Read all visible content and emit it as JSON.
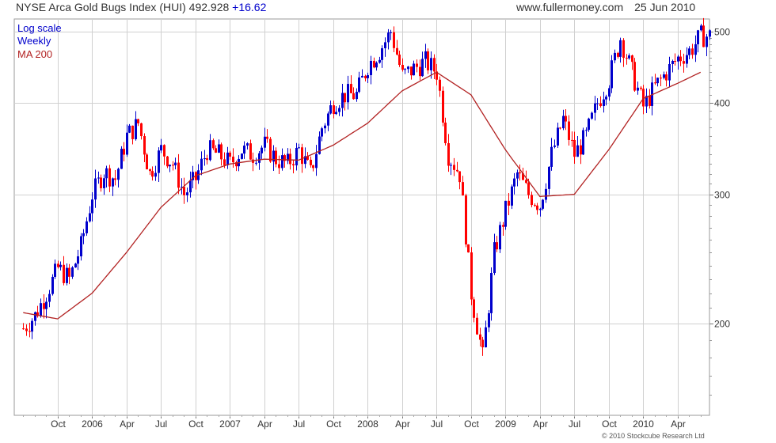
{
  "header": {
    "instrument": "NYSE Arca Gold Bugs Index (HUI)",
    "last": "492.928",
    "change": "+16.62",
    "site": "www.fullermoney.com",
    "date": "25 Jun 2010"
  },
  "legend": {
    "scale": "Log scale",
    "period": "Weekly",
    "ma": "MA 200"
  },
  "copyright": "© 2010 Stockcube Research Ltd",
  "colors": {
    "up": "#0000cc",
    "down": "#ff0000",
    "ma": "#b22222",
    "grid": "#d0d0d0"
  },
  "chart_data": {
    "type": "candlestick",
    "frequency": "weekly",
    "y_scale": "log",
    "ylim": [
      150,
      520
    ],
    "y_ticks": [
      200,
      300,
      400,
      500
    ],
    "x_ticks": [
      "Oct",
      "2006",
      "Apr",
      "Jul",
      "Oct",
      "2007",
      "Apr",
      "Jul",
      "Oct",
      "2008",
      "Apr",
      "Jul",
      "Oct",
      "2009",
      "Apr",
      "Jul",
      "Oct",
      "2010",
      "Apr"
    ],
    "x_range_months": [
      "2005-07",
      "2010-06"
    ],
    "grid": true,
    "series": [
      {
        "kind": "close",
        "points": [
          [
            "2005-07",
            197
          ],
          [
            "2005-08",
            205
          ],
          [
            "2005-09",
            220
          ],
          [
            "2005-10",
            238
          ],
          [
            "2005-11",
            230
          ],
          [
            "2005-12",
            255
          ],
          [
            "2006-01",
            300
          ],
          [
            "2006-02",
            322
          ],
          [
            "2006-03",
            315
          ],
          [
            "2006-04",
            360
          ],
          [
            "2006-05",
            375
          ],
          [
            "2006-06",
            320
          ],
          [
            "2006-07",
            345
          ],
          [
            "2006-08",
            330
          ],
          [
            "2006-09",
            300
          ],
          [
            "2006-10",
            315
          ],
          [
            "2006-11",
            345
          ],
          [
            "2006-12",
            340
          ],
          [
            "2007-01",
            330
          ],
          [
            "2007-02",
            345
          ],
          [
            "2007-03",
            340
          ],
          [
            "2007-04",
            350
          ],
          [
            "2007-05",
            335
          ],
          [
            "2007-06",
            330
          ],
          [
            "2007-07",
            345
          ],
          [
            "2007-08",
            320
          ],
          [
            "2007-09",
            370
          ],
          [
            "2007-10",
            400
          ],
          [
            "2007-11",
            410
          ],
          [
            "2007-12",
            410
          ],
          [
            "2008-01",
            450
          ],
          [
            "2008-02",
            470
          ],
          [
            "2008-03",
            500
          ],
          [
            "2008-04",
            435
          ],
          [
            "2008-05",
            445
          ],
          [
            "2008-06",
            455
          ],
          [
            "2008-07",
            440
          ],
          [
            "2008-08",
            340
          ],
          [
            "2008-09",
            320
          ],
          [
            "2008-10",
            220
          ],
          [
            "2008-11",
            180
          ],
          [
            "2008-12",
            250
          ],
          [
            "2009-01",
            285
          ],
          [
            "2009-02",
            320
          ],
          [
            "2009-03",
            300
          ],
          [
            "2009-04",
            290
          ],
          [
            "2009-05",
            340
          ],
          [
            "2009-06",
            380
          ],
          [
            "2009-07",
            340
          ],
          [
            "2009-08",
            360
          ],
          [
            "2009-09",
            400
          ],
          [
            "2009-10",
            430
          ],
          [
            "2009-11",
            490
          ],
          [
            "2009-12",
            440
          ],
          [
            "2010-01",
            395
          ],
          [
            "2010-02",
            420
          ],
          [
            "2010-03",
            440
          ],
          [
            "2010-04",
            460
          ],
          [
            "2010-05",
            470
          ],
          [
            "2010-06",
            493
          ]
        ]
      },
      {
        "kind": "ma",
        "name": "MA 200",
        "points": [
          [
            "2005-07",
            207
          ],
          [
            "2005-10",
            203
          ],
          [
            "2006-01",
            220
          ],
          [
            "2006-04",
            250
          ],
          [
            "2006-07",
            288
          ],
          [
            "2006-10",
            318
          ],
          [
            "2007-01",
            330
          ],
          [
            "2007-04",
            335
          ],
          [
            "2007-07",
            334
          ],
          [
            "2007-10",
            350
          ],
          [
            "2008-01",
            375
          ],
          [
            "2008-04",
            415
          ],
          [
            "2008-07",
            440
          ],
          [
            "2008-10",
            410
          ],
          [
            "2009-01",
            345
          ],
          [
            "2009-04",
            298
          ],
          [
            "2009-07",
            300
          ],
          [
            "2009-10",
            345
          ],
          [
            "2010-01",
            405
          ],
          [
            "2010-04",
            425
          ],
          [
            "2010-06",
            440
          ]
        ]
      }
    ]
  }
}
